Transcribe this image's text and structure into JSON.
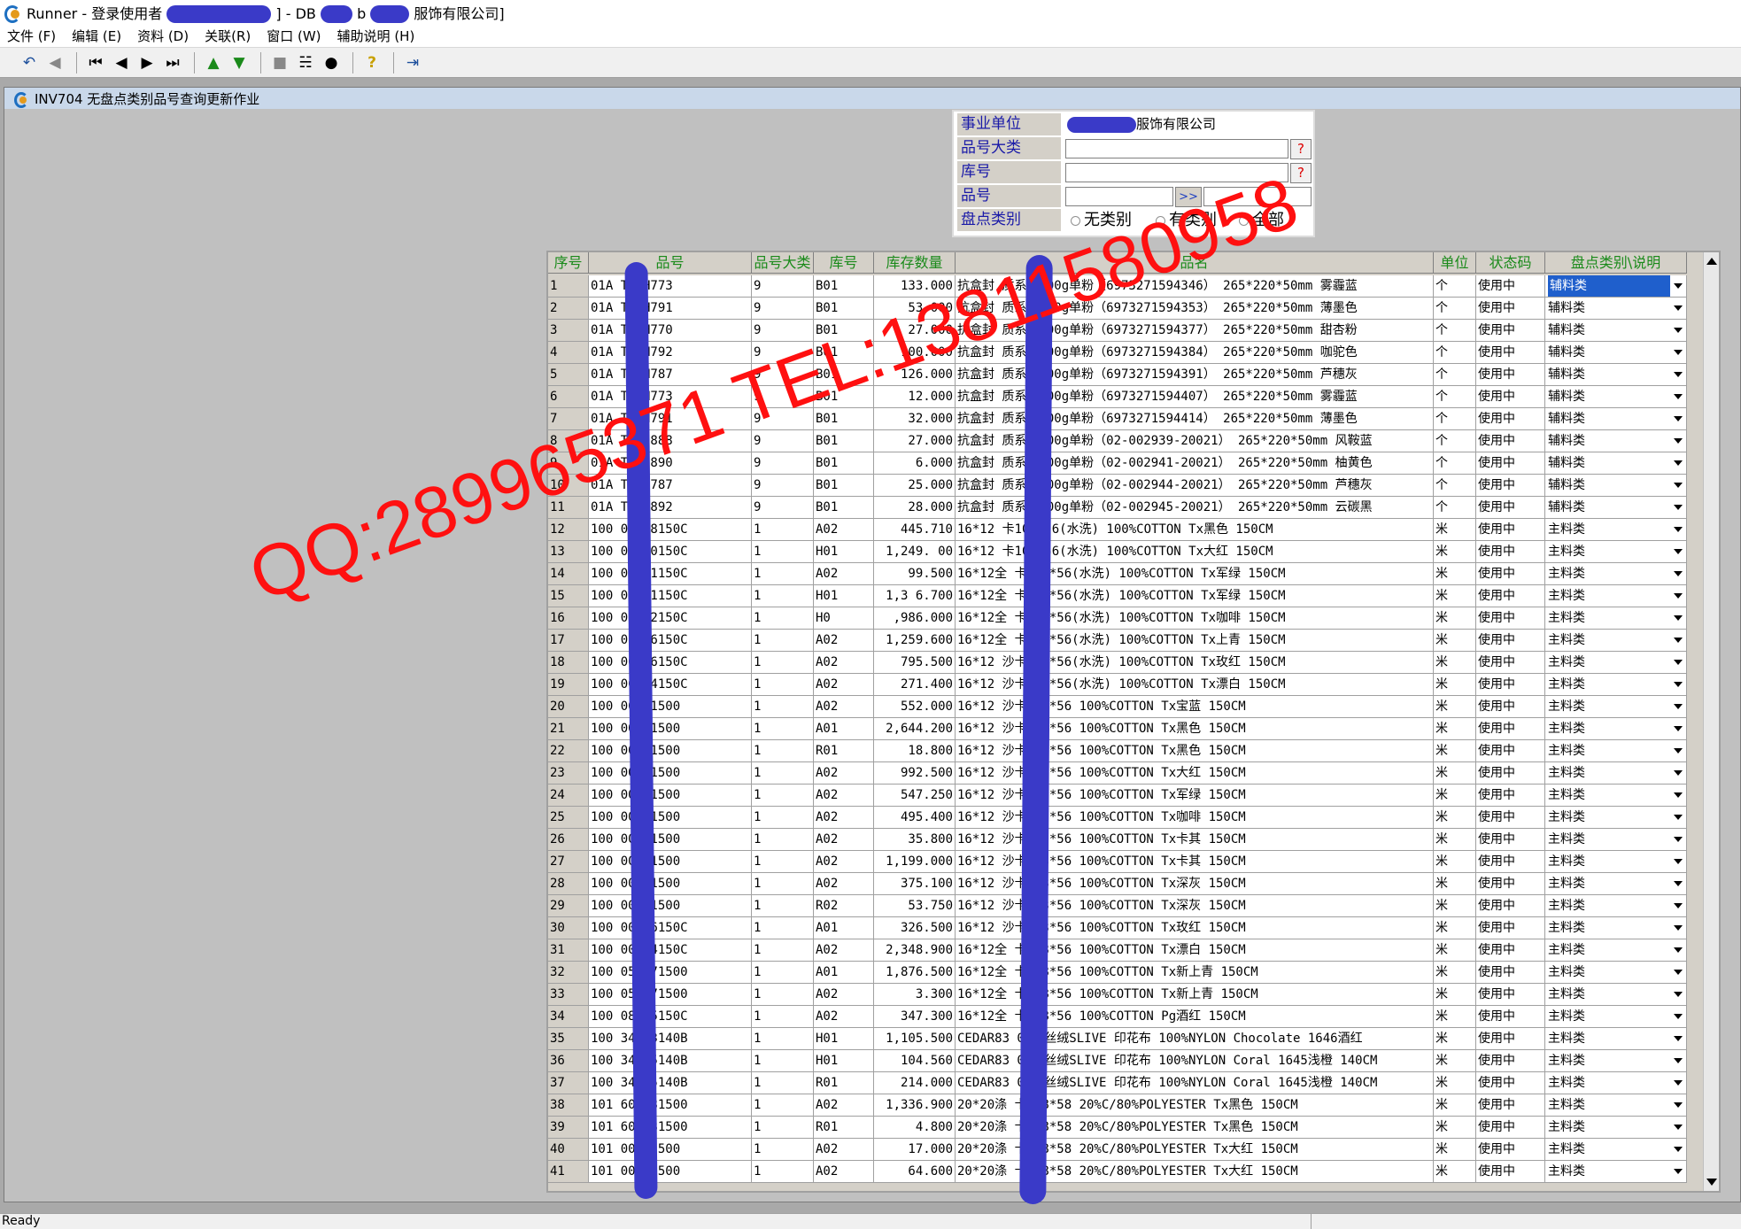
{
  "window": {
    "title_prefix": "Runner - 登录使用者",
    "title_mid": "- DB",
    "title_suffix": "服饰有限公司]"
  },
  "menu": [
    "文件 (F)",
    "编辑 (E)",
    "资料 (D)",
    "关联(R)",
    "窗口 (W)",
    "辅助说明 (H)"
  ],
  "toolbar_icons": [
    "undo-icon",
    "redo-icon",
    "first-record-icon",
    "prev-record-icon",
    "next-record-icon",
    "last-record-icon",
    "query-up-icon",
    "query-down-icon",
    "stop-icon",
    "tree-icon",
    "binoculars-icon",
    "help-icon",
    "exit-icon"
  ],
  "child": {
    "title": "INV704 无盘点类别品号查询更新作业"
  },
  "filter": {
    "unit_label": "事业单位",
    "unit_value": "服饰有限公司",
    "category_label": "品号大类",
    "category_value": "",
    "warehouse_label": "库号",
    "warehouse_value": "",
    "item_label": "品号",
    "item_from": "",
    "item_to": "",
    "range_button": ">>",
    "lookup_button": "?",
    "count_type_label": "盘点类别",
    "opt_none": "无类别",
    "opt_has": "有类别",
    "opt_all": "全部"
  },
  "grid": {
    "headers": [
      "序号",
      "品号",
      "品号大类",
      "库号",
      "库存数量",
      "品名",
      "单位",
      "状态码",
      "盘点类别\\说明"
    ],
    "rows": [
      [
        "1",
        "01A  TC0H773",
        "9",
        "B01",
        "133.000",
        "抗盒封  质系列300g单粉（6973271594346） 265*220*50mm  雾霾蓝",
        "个",
        "使用中",
        "辅料类"
      ],
      [
        "2",
        "01A  TC0H791",
        "9",
        "B01",
        "53.000",
        "抗盒封  质系列300g单粉（6973271594353） 265*220*50mm  薄墨色",
        "个",
        "使用中",
        "辅料类"
      ],
      [
        "3",
        "01A  TC0H770",
        "9",
        "B01",
        "27.000",
        "抗盒封  质系列300g单粉（6973271594377） 265*220*50mm  甜杏粉",
        "个",
        "使用中",
        "辅料类"
      ],
      [
        "4",
        "01A  TC0H792",
        "9",
        "B01",
        "100.000",
        "抗盒封  质系列300g单粉（6973271594384） 265*220*50mm  咖驼色",
        "个",
        "使用中",
        "辅料类"
      ],
      [
        "5",
        "01A  TC0H787",
        "9",
        "B01",
        "126.000",
        "抗盒封  质系列300g单粉（6973271594391） 265*220*50mm  芦穗灰",
        "个",
        "使用中",
        "辅料类"
      ],
      [
        "6",
        "01A  TC0H773",
        "9",
        "B01",
        "12.000",
        "抗盒封  质系列300g单粉（6973271594407） 265*220*50mm  雾霾蓝",
        "个",
        "使用中",
        "辅料类"
      ],
      [
        "7",
        "01A  TC0H791",
        "9",
        "B01",
        "32.000",
        "抗盒封  质系列300g单粉（6973271594414） 265*220*50mm  薄墨色",
        "个",
        "使用中",
        "辅料类"
      ],
      [
        "8",
        "01A  TC0H888",
        "9",
        "B01",
        "27.000",
        "抗盒封  质系列300g单粉（02-002939-20021） 265*220*50mm  风鞍蓝",
        "个",
        "使用中",
        "辅料类"
      ],
      [
        "9",
        "01A  TC0H890",
        "9",
        "B01",
        "6.000",
        "抗盒封  质系列300g单粉（02-002941-20021） 265*220*50mm  柚黄色",
        "个",
        "使用中",
        "辅料类"
      ],
      [
        "10",
        "01A  TC0H787",
        "9",
        "B01",
        "25.000",
        "抗盒封  质系列300g单粉（02-002944-20021） 265*220*50mm  芦穗灰",
        "个",
        "使用中",
        "辅料类"
      ],
      [
        "11",
        "01A  TC0H892",
        "9",
        "B01",
        "28.000",
        "抗盒封  质系列300g单粉（02-002945-20021） 265*220*50mm  云碳黑",
        "个",
        "使用中",
        "辅料类"
      ],
      [
        "12",
        "100  00018150C",
        "1",
        "A02",
        "445.710",
        "16*12  卡108*56(水洗)  100%COTTON  Tx黑色 150CM",
        "米",
        "使用中",
        "主料类"
      ],
      [
        "13",
        "100  00020150C",
        "1",
        "H01",
        "1,249.  00",
        "16*12  卡108*56(水洗)  100%COTTON  Tx大红 150CM",
        "米",
        "使用中",
        "主料类"
      ],
      [
        "14",
        "100  00021150C",
        "1",
        "A02",
        "  99.500",
        "16*12全  卡108*56(水洗)  100%COTTON  Tx军绿 150CM",
        "米",
        "使用中",
        "主料类"
      ],
      [
        "15",
        "100  00021150C",
        "1",
        "H01",
        "1,3  6.700",
        "16*12全  卡108*56(水洗)  100%COTTON  Tx军绿 150CM",
        "米",
        "使用中",
        "主料类"
      ],
      [
        "16",
        "100  00022150C",
        "1",
        "H0  ",
        "  ,986.000",
        "16*12全  卡108*56(水洗)   100%COTTON  Tx咖啡 150CM",
        "米",
        "使用中",
        "主料类"
      ],
      [
        "17",
        "100  00026150C",
        "1",
        "A02",
        "1,259.600",
        "16*12全  卡108*56(水洗)  100%COTTON  Tx上青 150CM",
        "米",
        "使用中",
        "主料类"
      ],
      [
        "18",
        "100  00076150C",
        "1",
        "A02",
        "795.500",
        "16*12  沙卡108*56(水洗)  100%COTTON  Tx玫红 150CM",
        "米",
        "使用中",
        "主料类"
      ],
      [
        "19",
        "100  00324150C",
        "1",
        "A02",
        "271.400",
        "16*12  沙卡108*56(水洗)   100%COTTON  Tx漂白 150CM",
        "米",
        "使用中",
        "主料类"
      ],
      [
        "20",
        "100  00161500",
        "1",
        "A02",
        "552.000",
        "16*12  沙卡108*56  100%COTTON  Tx宝蓝 150CM",
        "米",
        "使用中",
        "主料类"
      ],
      [
        "21",
        "100  00181500",
        "1",
        "A01",
        "2,644.200",
        "16*12  沙卡108*56  100%COTTON  Tx黑色 150CM",
        "米",
        "使用中",
        "主料类"
      ],
      [
        "22",
        "100  00181500",
        "1",
        "R01",
        "18.800",
        "16*12  沙卡108*56  100%COTTON  Tx黑色 150CM",
        "米",
        "使用中",
        "主料类"
      ],
      [
        "23",
        "100  00201500",
        "1",
        "A02",
        "992.500",
        "16*12  沙卡108*56  100%COTTON  Tx大红 150CM",
        "米",
        "使用中",
        "主料类"
      ],
      [
        "24",
        "100  00211500",
        "1",
        "A02",
        "547.250",
        "16*12  沙卡108*56  100%COTTON  Tx军绿 150CM",
        "米",
        "使用中",
        "主料类"
      ],
      [
        "25",
        "100  00221500",
        "1",
        "A02",
        "495.400",
        "16*12  沙卡108*56  100%COTTON  Tx咖啡 150CM",
        "米",
        "使用中",
        "主料类"
      ],
      [
        "26",
        "100  00231500",
        "1",
        "A02",
        "35.800",
        "16*12  沙卡108*56  100%COTTON  Tx卡其 150CM",
        "米",
        "使用中",
        "主料类"
      ],
      [
        "27",
        "100  00231500",
        "1",
        "A02",
        "1,199.000",
        "16*12  沙卡108*56  100%COTTON  Tx卡其 150CM",
        "米",
        "使用中",
        "主料类"
      ],
      [
        "28",
        "100  00251500",
        "1",
        "A02",
        "375.100",
        "16*12  沙卡108*56  100%COTTON  Tx深灰 150CM",
        "米",
        "使用中",
        "主料类"
      ],
      [
        "29",
        "100  00251500",
        "1",
        "R02",
        "53.750",
        "16*12  沙卡108*56  100%COTTON  Tx深灰 150CM",
        "米",
        "使用中",
        "主料类"
      ],
      [
        "30",
        "100  00076150C",
        "1",
        "A01",
        "326.500",
        "16*12  沙卡108*56  100%COTTON  Tx玫红 150CM",
        "米",
        "使用中",
        "主料类"
      ],
      [
        "31",
        "100  00324150C",
        "1",
        "A02",
        "2,348.900",
        "16*12全  卡108*56  100%COTTON  Tx漂白 150CM",
        "米",
        "使用中",
        "主料类"
      ],
      [
        "32",
        "100  053571500",
        "1",
        "A01",
        "1,876.500",
        "16*12全  卡108*56  100%COTTON  Tx新上青 150CM",
        "米",
        "使用中",
        "主料类"
      ],
      [
        "33",
        "100  053571500",
        "1",
        "A02",
        "3.300",
        "16*12全  卡108*56  100%COTTON  Tx新上青 150CM",
        "米",
        "使用中",
        "主料类"
      ],
      [
        "34",
        "100  08015150C",
        "1",
        "A02",
        "347.300",
        "16*12全  卡108*56  100%COTTON  Pg酒红 150CM",
        "米",
        "使用中",
        "主料类"
      ],
      [
        "35",
        "100  34913140B",
        "1",
        "H01",
        "1,105.500",
        "CEDAR83  04塔丝绒SLIVE 印花布  100%NYLON  Chocolate 1646酒红",
        "米",
        "使用中",
        "主料类"
      ],
      [
        "36",
        "100  34915140B",
        "1",
        "H01",
        "104.560",
        "CEDAR83  04塔丝绒SLIVE 印花布  100%NYLON  Coral 1645浅橙 140CM",
        "米",
        "使用中",
        "主料类"
      ],
      [
        "37",
        "100  34915140B",
        "1",
        "R01",
        "214.000",
        "CEDAR83  04塔丝绒SLIVE 印花布  100%NYLON  Coral 1645浅橙 140CM",
        "米",
        "使用中",
        "主料类"
      ],
      [
        "38",
        "101  600181500",
        "1",
        "A02",
        "1,336.900",
        "20*20涤  卡108*58  20%C/80%POLYESTER  Tx黑色 150CM",
        "米",
        "使用中",
        "主料类"
      ],
      [
        "39",
        "101  600181500",
        "1",
        "R01",
        "4.800",
        "20*20涤  卡108*58  20%C/80%POLYESTER  Tx黑色 150CM",
        "米",
        "使用中",
        "主料类"
      ],
      [
        "40",
        "101  00201500",
        "1",
        "A02",
        "17.000",
        "20*20涤  卡108*58  20%C/80%POLYESTER  Tx大红 150CM",
        "米",
        "使用中",
        "主料类"
      ],
      [
        "41",
        "101  00201500",
        "1",
        "A02",
        "64.600",
        "20*20涤  卡108*58  20%C/80%POLYESTER  Tx大红 150CM",
        "米",
        "使用中",
        "主料类"
      ]
    ]
  },
  "watermark": "QQ:289965371 TEL:13811580958",
  "status": {
    "text": "Ready"
  },
  "colors": {
    "header_text": "#1a8a1a",
    "label_text": "#1a1aa8",
    "selection": "#1f5fcc",
    "watermark": "#ff1010",
    "redaction": "#3a3ac8"
  }
}
